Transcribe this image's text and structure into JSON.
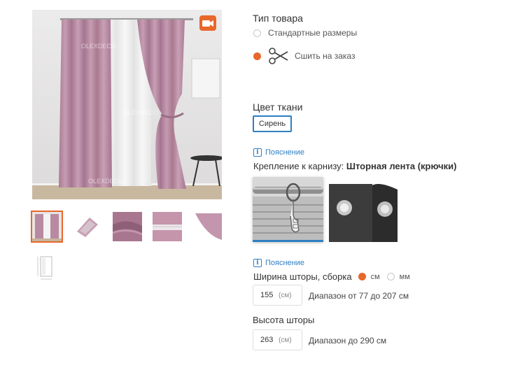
{
  "gallery": {
    "watermark": "OLEXDECO",
    "video_label": "video",
    "thumbnails": [
      "curtain-full",
      "package",
      "fabric-fold",
      "fabric-tape",
      "fabric-corner",
      "size-scheme"
    ]
  },
  "product_type": {
    "title": "Тип товара",
    "options": [
      {
        "label": "Стандартные размеры",
        "selected": false
      },
      {
        "label": "Сшить на заказ",
        "selected": true
      }
    ]
  },
  "fabric_color": {
    "title": "Цвет ткани",
    "selected": "Сирень"
  },
  "mount": {
    "hint": "Пояснение",
    "label": "Крепление к карнизу:",
    "value": "Шторная лента (крючки)",
    "options": [
      "hooks",
      "grommets"
    ]
  },
  "width": {
    "hint": "Пояснение",
    "label": "Ширина шторы, сборка",
    "unit_options": [
      {
        "label": "см",
        "selected": true
      },
      {
        "label": "мм",
        "selected": false
      }
    ],
    "value": "155",
    "unit": "(см)",
    "range": "Диапазон от 77 до 207 см"
  },
  "height": {
    "label": "Высота шторы",
    "value": "263",
    "unit": "(см)",
    "range": "Диапазон до 290 см"
  },
  "colors": {
    "accent": "#e8672b",
    "link": "#2f7fc1",
    "curtain": "#b98aa3"
  }
}
